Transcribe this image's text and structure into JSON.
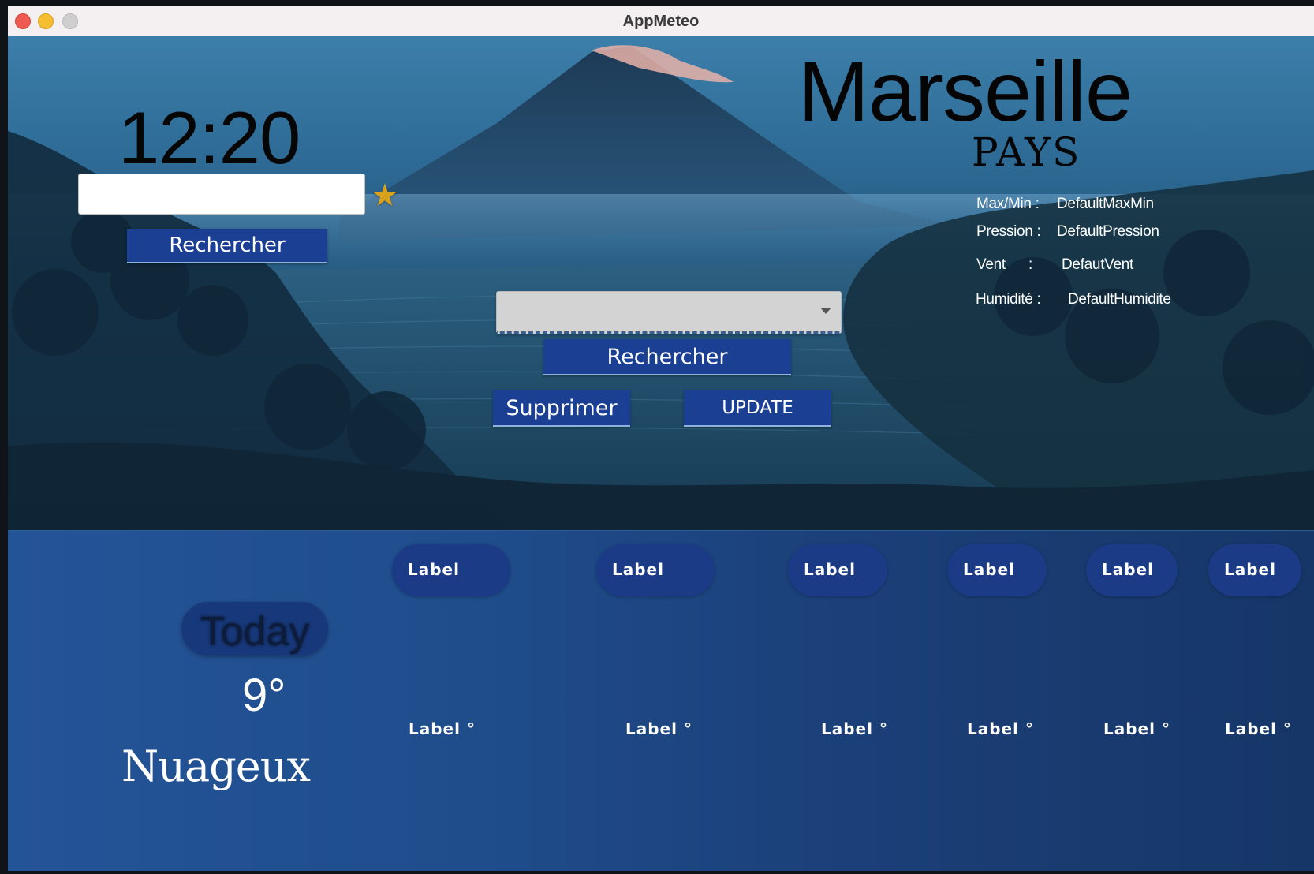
{
  "window": {
    "title": "AppMeteo"
  },
  "clock": {
    "time": "12:20"
  },
  "search": {
    "placeholder": "",
    "value": "",
    "button_label": "Rechercher"
  },
  "favorites": {
    "selected": "",
    "search_label": "Rechercher",
    "delete_label": "Supprimer",
    "update_label": "UPDATE"
  },
  "location": {
    "city": "Marseille",
    "country": "PAYS"
  },
  "details": {
    "maxmin_label": "Max/Min :",
    "maxmin_value": "DefaultMaxMin",
    "pression_label": "Pression :",
    "pression_value": "DefaultPression",
    "vent_label": "Vent",
    "vent_sep": ":",
    "vent_value": "DefautVent",
    "humidite_label": "Humidité :",
    "humidite_value": "DefaultHumidite"
  },
  "today": {
    "label": "Today",
    "temperature": "9°",
    "condition": "Nuageux"
  },
  "forecast": [
    {
      "day": "Label",
      "temp": "Label °"
    },
    {
      "day": "Label",
      "temp": "Label °"
    },
    {
      "day": "Label",
      "temp": "Label °"
    },
    {
      "day": "Label",
      "temp": "Label °"
    },
    {
      "day": "Label",
      "temp": "Label °"
    },
    {
      "day": "Label",
      "temp": "Label °"
    }
  ],
  "icons": {
    "favorite": "star-icon",
    "dropdown": "chevron-down-icon"
  },
  "colors": {
    "accent": "#1b3f93",
    "star": "#d8a21c",
    "panel": "#1f4d8c"
  }
}
